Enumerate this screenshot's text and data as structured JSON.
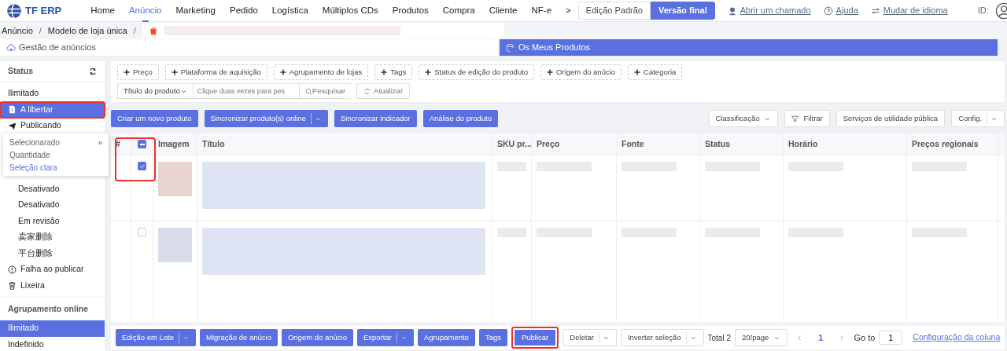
{
  "top_nav": {
    "logo": "TF ERP",
    "items": [
      {
        "label": "Home",
        "selected": false
      },
      {
        "label": "Anúncio",
        "selected": true
      },
      {
        "label": "Marketing",
        "selected": false
      },
      {
        "label": "Pedido",
        "selected": false
      },
      {
        "label": "Logística",
        "selected": false
      },
      {
        "label": "Múltiplos CDs",
        "selected": false
      },
      {
        "label": "Produtos",
        "selected": false
      },
      {
        "label": "Compra",
        "selected": false
      },
      {
        "label": "Cliente",
        "selected": false
      },
      {
        "label": "NF-e",
        "selected": false
      }
    ],
    "more": ">",
    "edition": [
      {
        "label": "Edição Padrão",
        "selected": false
      },
      {
        "label": "Versão final",
        "selected": true
      }
    ],
    "links": [
      {
        "label": "Abrir um chamado",
        "kind": "support"
      },
      {
        "label": "Ajuda",
        "kind": "help"
      },
      {
        "label": "Mudar de idioma",
        "kind": "language"
      }
    ],
    "id_label": "ID:"
  },
  "breadcrumb": [
    {
      "label": "Anúncio",
      "separator": "/"
    },
    {
      "label": "Modelo de loja única",
      "separator": "/"
    }
  ],
  "page_tabs": [
    {
      "label": "Gestão de anúncios",
      "selected": false
    },
    {
      "label": "Os Meus Produtos",
      "selected": true
    }
  ],
  "sidebar": {
    "sections": [
      {
        "title": "Status",
        "items": [
          {
            "label": "Ilimitado",
            "kind": "plain",
            "selected": false,
            "highlighted": false
          },
          {
            "label": "A libertar",
            "kind": "draft",
            "selected": true,
            "highlighted": true
          },
          {
            "label": "Publicando",
            "kind": "publishing",
            "selected": false,
            "highlighted": false
          },
          {
            "label": "Desativado",
            "kind": "sub",
            "selected": false,
            "highlighted": false
          },
          {
            "label": "Desativado",
            "kind": "sub",
            "selected": false,
            "highlighted": false
          },
          {
            "label": "Em revisão",
            "kind": "sub",
            "selected": false,
            "highlighted": false
          },
          {
            "label": "卖家删除",
            "kind": "sub",
            "selected": false,
            "highlighted": false
          },
          {
            "label": "平台删除",
            "kind": "sub",
            "selected": false,
            "highlighted": false
          },
          {
            "label": "Falha ao publicar",
            "kind": "failed",
            "selected": false,
            "highlighted": false
          },
          {
            "label": "Lixeira",
            "kind": "trash",
            "selected": false,
            "highlighted": false
          }
        ]
      },
      {
        "title": "Agrupamento online",
        "items": [
          {
            "label": "Ilimitado",
            "kind": "plain",
            "selected": true,
            "highlighted": false
          },
          {
            "label": "Indefinido",
            "kind": "plain",
            "selected": false,
            "highlighted": false
          }
        ]
      }
    ]
  },
  "selection_popup": {
    "title": "Selecionarado",
    "expand": "»",
    "count_label": "Quantidade",
    "clear": "Seleção clara"
  },
  "filter_tags": [
    "Preço",
    "Plataforma de aquisição",
    "Agrupamento de lojas",
    "Tags",
    "Status de edição do produto",
    "Origem do anúcio",
    "Categoria"
  ],
  "search": {
    "field": "Título do produto",
    "placeholder": "Clique duas vezes para pes",
    "button": "Pesquisar",
    "refresh": "Atualizar"
  },
  "actions": [
    {
      "label": "Criar um novo produto",
      "split": false
    },
    {
      "label": "Sincronizar produto(s) online",
      "split": true
    },
    {
      "label": "Sincronizar indicador",
      "split": false
    },
    {
      "label": "Análise do produto",
      "split": false
    }
  ],
  "tools": [
    {
      "label": "Classificação",
      "kind": "dropdown"
    },
    {
      "label": "Filtrar",
      "kind": "filter"
    },
    {
      "label": "Serviços de utilidade pública",
      "kind": "plain"
    },
    {
      "label": "Config.",
      "kind": "split"
    }
  ],
  "table": {
    "columns": [
      "#",
      "Imagem",
      "Título",
      "SKU pr...",
      "Preço",
      "Fonte",
      "Status",
      "Horário",
      "Preços regionais"
    ],
    "header_indeterminate": true,
    "select_column_highlighted": true,
    "rows": [
      {
        "checked": true
      },
      {
        "checked": false
      }
    ]
  },
  "bottom_bar": {
    "buttons": [
      {
        "label": "Edição em Lote",
        "split": true,
        "highlighted": false
      },
      {
        "label": "Migração de anúcio",
        "split": false,
        "highlighted": false
      },
      {
        "label": "Origem do anúcio",
        "split": false,
        "highlighted": false
      },
      {
        "label": "Exportar",
        "split": true,
        "highlighted": false
      },
      {
        "label": "Agrupamento",
        "split": false,
        "highlighted": false
      },
      {
        "label": "Tags",
        "split": false,
        "highlighted": false
      },
      {
        "label": "Publicar",
        "split": false,
        "highlighted": true
      }
    ],
    "dropdowns": [
      "Deletar",
      "Inverter seleção"
    ],
    "total": "Total 2",
    "page_size": "20/page",
    "pages": [
      {
        "label": "1",
        "selected": true
      }
    ],
    "goto_label": "Go to",
    "goto_value": "1",
    "column_config": "Configuração da coluna"
  }
}
